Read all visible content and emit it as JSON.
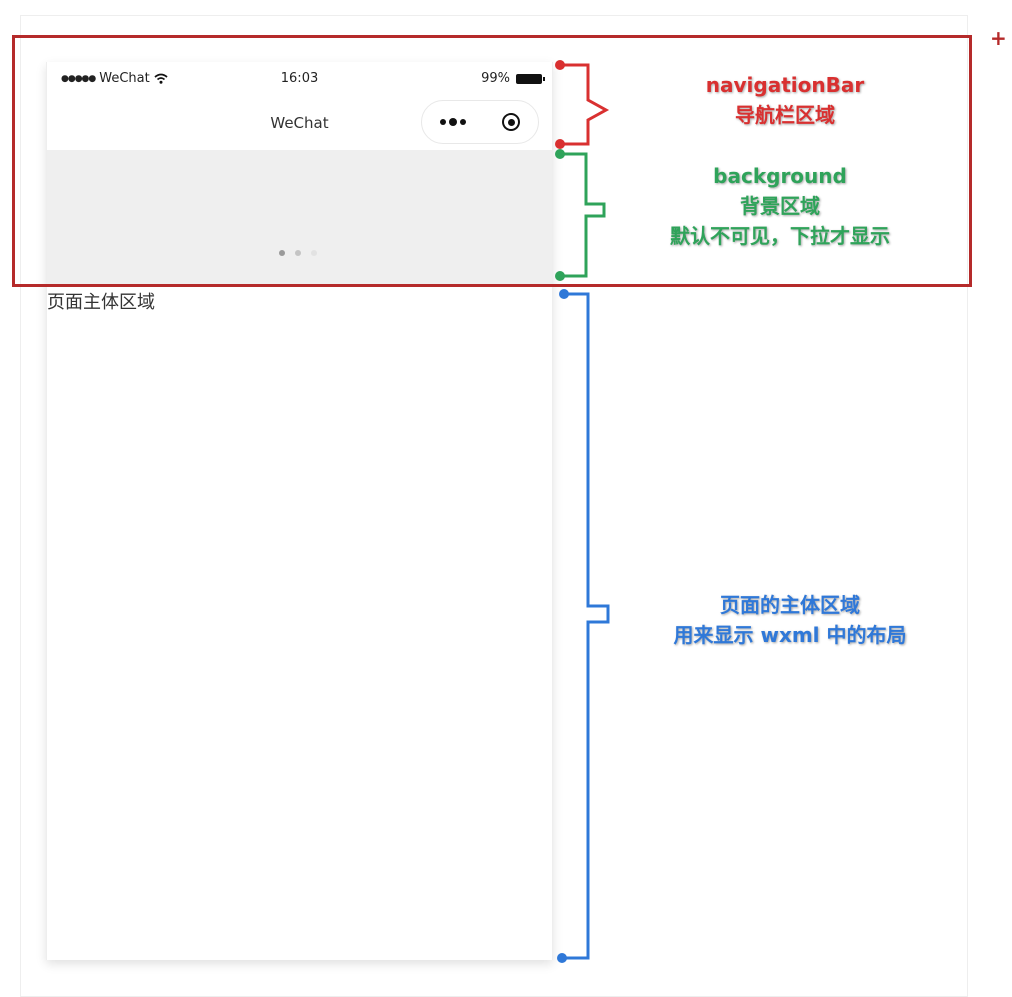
{
  "status_bar": {
    "carrier": "WeChat",
    "signal_dots": "●●●●●",
    "time": "16:03",
    "battery_percent": "99%"
  },
  "navigation_bar": {
    "title": "WeChat",
    "capsule": {
      "more_icon": "more-dots-icon",
      "close_icon": "target-icon"
    }
  },
  "background_area": {
    "loading_dots_colors": [
      "#9a9a9a",
      "#c4c4c4",
      "#e2e2e2"
    ]
  },
  "page_body": {
    "text": "页面主体区域"
  },
  "annotations": {
    "navigation": {
      "title": "navigationBar",
      "subtitle": "导航栏区域",
      "color": "#d93030"
    },
    "background": {
      "title": "background",
      "subtitle": "背景区域",
      "note": "默认不可见，下拉才显示",
      "color": "#2fa35a"
    },
    "body": {
      "title": "页面的主体区域",
      "subtitle": "用来显示 wxml 中的布局",
      "color": "#2f78d8"
    },
    "highlight_box_color": "#b52a2a",
    "plus_mark": "+"
  }
}
